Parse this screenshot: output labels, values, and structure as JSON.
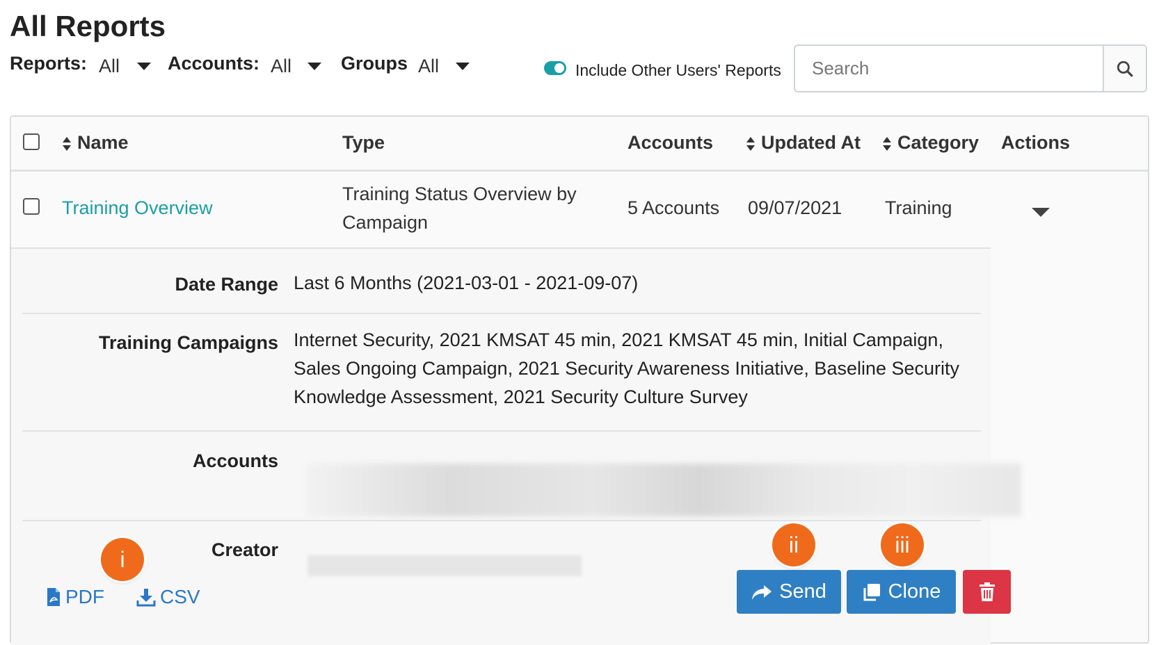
{
  "page": {
    "title": "All Reports"
  },
  "filters": {
    "reports_label": "Reports:",
    "reports_value": "All",
    "accounts_label": "Accounts:",
    "accounts_value": "All",
    "groups_label": "Groups",
    "groups_value": "All",
    "include_other_label": "Include Other Users' Reports",
    "include_other_on": true
  },
  "search": {
    "placeholder": "Search",
    "icon": "search-icon"
  },
  "table": {
    "headers": {
      "name": "Name",
      "type": "Type",
      "accounts": "Accounts",
      "updated_at": "Updated At",
      "category": "Category",
      "actions": "Actions"
    },
    "rows": [
      {
        "name": "Training Overview",
        "type_line1": "Training Status Overview by",
        "type_line2": "Campaign",
        "accounts": "5 Accounts",
        "updated_at": "09/07/2021",
        "category": "Training"
      }
    ]
  },
  "details": {
    "date_range_label": "Date Range",
    "date_range_value": "Last 6 Months (2021-03-01 - 2021-09-07)",
    "campaigns_label": "Training Campaigns",
    "campaigns_line1": "Internet Security, 2021 KMSAT 45 min, 2021 KMSAT 45 min, Initial Campaign,",
    "campaigns_line2": "Sales Ongoing Campaign, 2021 Security Awareness Initiative, Baseline Security",
    "campaigns_line3": "Knowledge Assessment, 2021 Security Culture Survey",
    "accounts_label": "Accounts",
    "creator_label": "Creator"
  },
  "actions": {
    "pdf_label": "PDF",
    "csv_label": "CSV",
    "send_label": "Send",
    "clone_label": "Clone",
    "delete_icon": "trash-icon"
  },
  "markers": {
    "i": "i",
    "ii": "ii",
    "iii": "iii"
  },
  "colors": {
    "accent_teal": "#1a9ea8",
    "button_blue": "#2f7fc4",
    "button_red": "#dc3545",
    "marker_orange": "#ef6a1a"
  }
}
